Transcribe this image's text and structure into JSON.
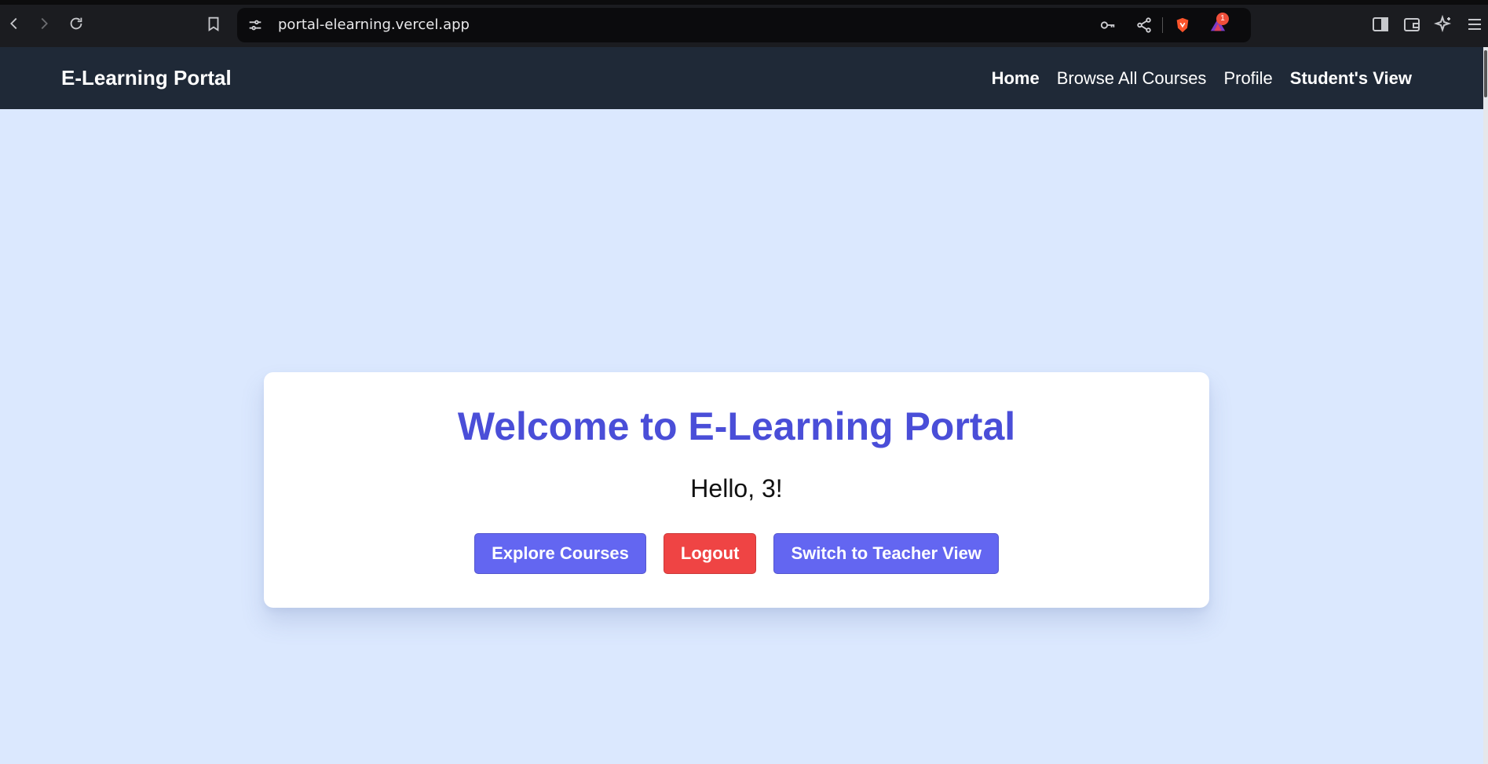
{
  "browser": {
    "url": "portal-elearning.vercel.app",
    "notification_count": "1",
    "icons": [
      "back-icon",
      "forward-icon",
      "reload-icon",
      "bookmark-icon",
      "site-settings-icon",
      "key-icon",
      "share-icon",
      "brave-shield-icon",
      "rewards-icon",
      "sidebar-icon",
      "wallet-icon",
      "leo-ai-icon",
      "menu-icon"
    ]
  },
  "header": {
    "brand": "E-Learning Portal",
    "nav": [
      {
        "label": "Home"
      },
      {
        "label": "Browse All Courses"
      },
      {
        "label": "Profile"
      },
      {
        "label": "Student's View"
      }
    ]
  },
  "main": {
    "title": "Welcome to E-Learning Portal",
    "greeting": "Hello, 3!",
    "buttons": {
      "explore": "Explore Courses",
      "logout": "Logout",
      "switch": "Switch to Teacher View"
    }
  },
  "colors": {
    "page_background": "#dbe8fe",
    "header_background": "#1f2937",
    "title": "#4a4ed8",
    "primary_button": "#6366f1",
    "danger_button": "#ef4444"
  }
}
